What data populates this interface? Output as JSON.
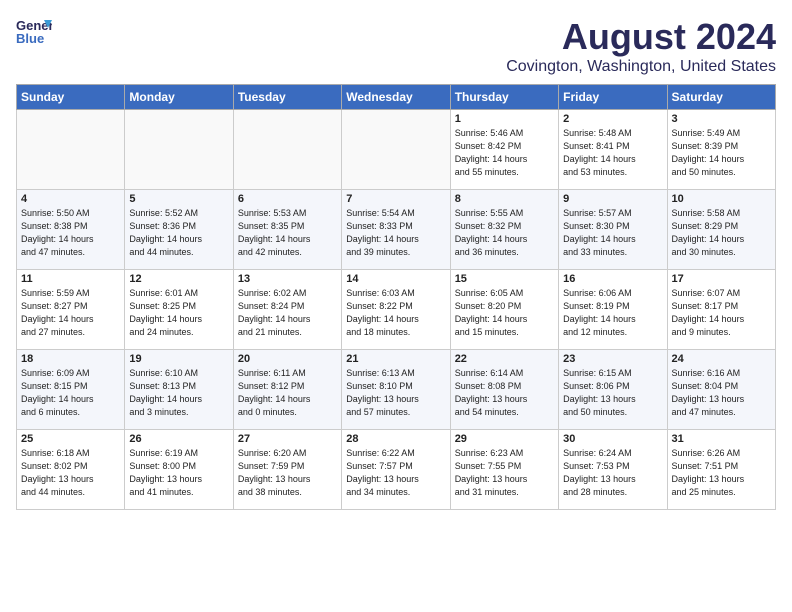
{
  "header": {
    "logo_line1": "General",
    "logo_line2": "Blue",
    "title": "August 2024",
    "subtitle": "Covington, Washington, United States"
  },
  "weekdays": [
    "Sunday",
    "Monday",
    "Tuesday",
    "Wednesday",
    "Thursday",
    "Friday",
    "Saturday"
  ],
  "weeks": [
    [
      {
        "day": "",
        "info": ""
      },
      {
        "day": "",
        "info": ""
      },
      {
        "day": "",
        "info": ""
      },
      {
        "day": "",
        "info": ""
      },
      {
        "day": "1",
        "info": "Sunrise: 5:46 AM\nSunset: 8:42 PM\nDaylight: 14 hours\nand 55 minutes."
      },
      {
        "day": "2",
        "info": "Sunrise: 5:48 AM\nSunset: 8:41 PM\nDaylight: 14 hours\nand 53 minutes."
      },
      {
        "day": "3",
        "info": "Sunrise: 5:49 AM\nSunset: 8:39 PM\nDaylight: 14 hours\nand 50 minutes."
      }
    ],
    [
      {
        "day": "4",
        "info": "Sunrise: 5:50 AM\nSunset: 8:38 PM\nDaylight: 14 hours\nand 47 minutes."
      },
      {
        "day": "5",
        "info": "Sunrise: 5:52 AM\nSunset: 8:36 PM\nDaylight: 14 hours\nand 44 minutes."
      },
      {
        "day": "6",
        "info": "Sunrise: 5:53 AM\nSunset: 8:35 PM\nDaylight: 14 hours\nand 42 minutes."
      },
      {
        "day": "7",
        "info": "Sunrise: 5:54 AM\nSunset: 8:33 PM\nDaylight: 14 hours\nand 39 minutes."
      },
      {
        "day": "8",
        "info": "Sunrise: 5:55 AM\nSunset: 8:32 PM\nDaylight: 14 hours\nand 36 minutes."
      },
      {
        "day": "9",
        "info": "Sunrise: 5:57 AM\nSunset: 8:30 PM\nDaylight: 14 hours\nand 33 minutes."
      },
      {
        "day": "10",
        "info": "Sunrise: 5:58 AM\nSunset: 8:29 PM\nDaylight: 14 hours\nand 30 minutes."
      }
    ],
    [
      {
        "day": "11",
        "info": "Sunrise: 5:59 AM\nSunset: 8:27 PM\nDaylight: 14 hours\nand 27 minutes."
      },
      {
        "day": "12",
        "info": "Sunrise: 6:01 AM\nSunset: 8:25 PM\nDaylight: 14 hours\nand 24 minutes."
      },
      {
        "day": "13",
        "info": "Sunrise: 6:02 AM\nSunset: 8:24 PM\nDaylight: 14 hours\nand 21 minutes."
      },
      {
        "day": "14",
        "info": "Sunrise: 6:03 AM\nSunset: 8:22 PM\nDaylight: 14 hours\nand 18 minutes."
      },
      {
        "day": "15",
        "info": "Sunrise: 6:05 AM\nSunset: 8:20 PM\nDaylight: 14 hours\nand 15 minutes."
      },
      {
        "day": "16",
        "info": "Sunrise: 6:06 AM\nSunset: 8:19 PM\nDaylight: 14 hours\nand 12 minutes."
      },
      {
        "day": "17",
        "info": "Sunrise: 6:07 AM\nSunset: 8:17 PM\nDaylight: 14 hours\nand 9 minutes."
      }
    ],
    [
      {
        "day": "18",
        "info": "Sunrise: 6:09 AM\nSunset: 8:15 PM\nDaylight: 14 hours\nand 6 minutes."
      },
      {
        "day": "19",
        "info": "Sunrise: 6:10 AM\nSunset: 8:13 PM\nDaylight: 14 hours\nand 3 minutes."
      },
      {
        "day": "20",
        "info": "Sunrise: 6:11 AM\nSunset: 8:12 PM\nDaylight: 14 hours\nand 0 minutes."
      },
      {
        "day": "21",
        "info": "Sunrise: 6:13 AM\nSunset: 8:10 PM\nDaylight: 13 hours\nand 57 minutes."
      },
      {
        "day": "22",
        "info": "Sunrise: 6:14 AM\nSunset: 8:08 PM\nDaylight: 13 hours\nand 54 minutes."
      },
      {
        "day": "23",
        "info": "Sunrise: 6:15 AM\nSunset: 8:06 PM\nDaylight: 13 hours\nand 50 minutes."
      },
      {
        "day": "24",
        "info": "Sunrise: 6:16 AM\nSunset: 8:04 PM\nDaylight: 13 hours\nand 47 minutes."
      }
    ],
    [
      {
        "day": "25",
        "info": "Sunrise: 6:18 AM\nSunset: 8:02 PM\nDaylight: 13 hours\nand 44 minutes."
      },
      {
        "day": "26",
        "info": "Sunrise: 6:19 AM\nSunset: 8:00 PM\nDaylight: 13 hours\nand 41 minutes."
      },
      {
        "day": "27",
        "info": "Sunrise: 6:20 AM\nSunset: 7:59 PM\nDaylight: 13 hours\nand 38 minutes."
      },
      {
        "day": "28",
        "info": "Sunrise: 6:22 AM\nSunset: 7:57 PM\nDaylight: 13 hours\nand 34 minutes."
      },
      {
        "day": "29",
        "info": "Sunrise: 6:23 AM\nSunset: 7:55 PM\nDaylight: 13 hours\nand 31 minutes."
      },
      {
        "day": "30",
        "info": "Sunrise: 6:24 AM\nSunset: 7:53 PM\nDaylight: 13 hours\nand 28 minutes."
      },
      {
        "day": "31",
        "info": "Sunrise: 6:26 AM\nSunset: 7:51 PM\nDaylight: 13 hours\nand 25 minutes."
      }
    ]
  ]
}
